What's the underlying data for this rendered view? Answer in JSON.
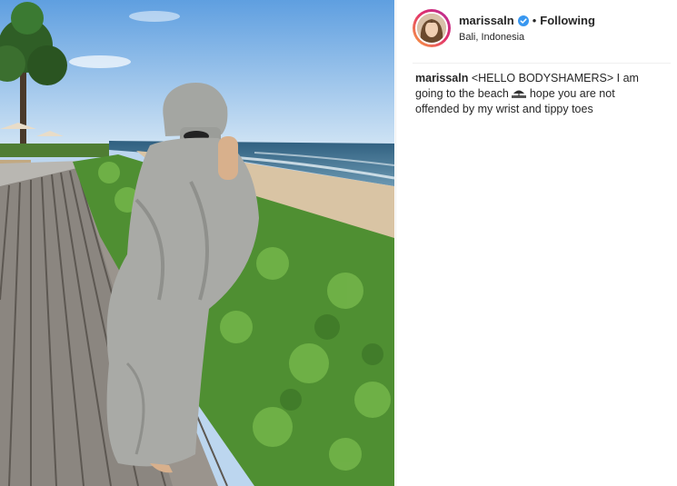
{
  "post": {
    "username": "marissaln",
    "follow_status": "Following",
    "location": "Bali, Indonesia",
    "caption": {
      "username": "marissaln",
      "text_before_emoji": "<HELLO BODYSHAMERS> I am going to the beach",
      "emoji": "beach-with-umbrella",
      "text_after_emoji": "hope you are not offended by my wrist and tippy toes"
    }
  },
  "colors": {
    "verified_badge": "#3897f0",
    "avatar_ring_start": "#f9a53e",
    "avatar_ring_end": "#b32c9a",
    "text": "#262626",
    "divider": "#efefef"
  },
  "icons": {
    "verified": "verified-badge-icon",
    "separator": "bullet-dot"
  }
}
